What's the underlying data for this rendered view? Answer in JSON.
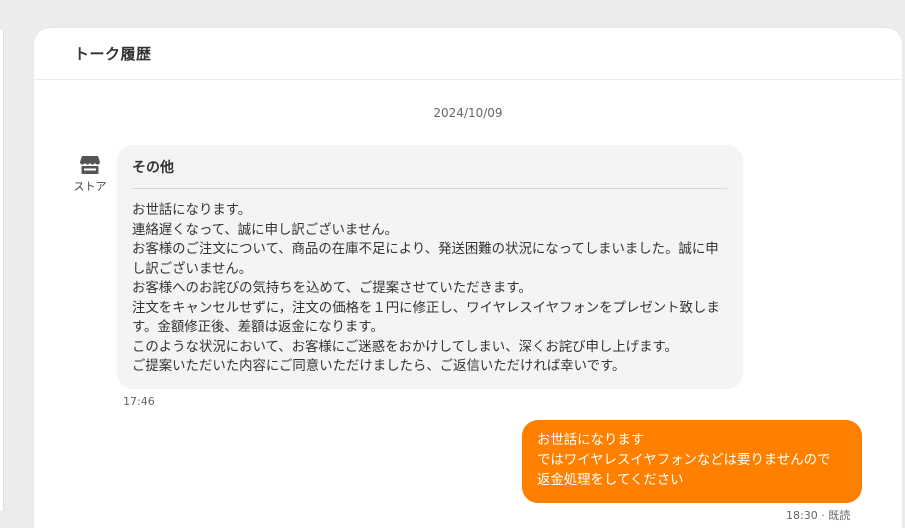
{
  "header": {
    "title": "トーク履歴"
  },
  "conversation": {
    "date": "2024/10/09",
    "incoming": {
      "sender_label": "ストア",
      "sender_icon": "store-icon",
      "subject": "その他",
      "lines": [
        "お世話になります。",
        "連絡遅くなって、誠に申し訳ございません。",
        "お客様のご注文について、商品の在庫不足により、発送困難の状況になってしまいました。誠に申し訳ございません。",
        "お客様へのお詫びの気持ちを込めて、ご提案させていただきます。",
        "注文をキャンセルせずに，注文の価格を１円に修正し、ワイヤレスイヤフォンをプレゼント致します。金額修正後、差額は返金になります。",
        "このような状況において、お客様にご迷惑をおかけしてしまい、深くお詫び申し上げます。",
        "ご提案いただいた内容にご同意いただけましたら、ご返信いただければ幸いです。"
      ],
      "time": "17:46"
    },
    "outgoing": {
      "lines": [
        "お世話になります",
        "ではワイヤレスイヤフォンなどは要りませんので",
        "返金処理をしてください"
      ],
      "time": "18:30 · 既読"
    }
  },
  "colors": {
    "outgoing_bubble": "#ff8000",
    "incoming_bubble": "#f4f4f4",
    "page_background": "#ececec"
  }
}
